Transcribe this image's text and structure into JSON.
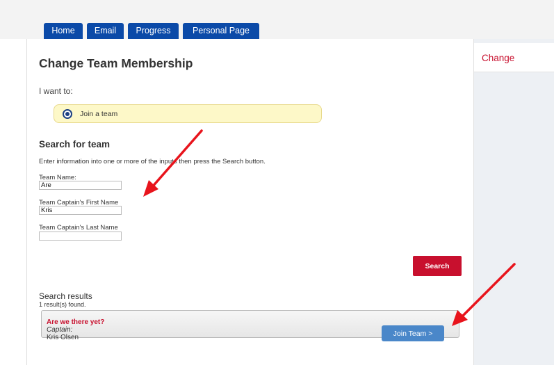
{
  "tabs": {
    "home": "Home",
    "email": "Email",
    "progress": "Progress",
    "personal": "Personal Page"
  },
  "right_panel": {
    "title": "Change"
  },
  "page": {
    "title": "Change Team Membership",
    "i_want_to": "I want to:",
    "join_option": "Join a team",
    "join_selected": true
  },
  "search": {
    "heading": "Search for team",
    "instructions": "Enter information into one or more of the inputs then press the Search button.",
    "fields": {
      "team_name": {
        "label": "Team Name:",
        "value": "Are"
      },
      "captain_first": {
        "label": "Team Captain's First Name",
        "value": "Kris"
      },
      "captain_last": {
        "label": "Team Captain's Last Name",
        "value": ""
      }
    },
    "button_label": "Search"
  },
  "results": {
    "heading": "Search results",
    "count_text": "1 result(s) found.",
    "items": [
      {
        "team_name": "Are we there yet?",
        "captain_label": "Captain:",
        "captain_name": "Kris Olsen",
        "join_label": "Join Team >"
      }
    ]
  },
  "colors": {
    "tab_blue": "#0b4aa8",
    "accent_red": "#c8102e",
    "join_button_blue": "#4a87c9",
    "highlight_yellow": "#fdf8c8",
    "annotation_arrow": "#e8141c"
  },
  "icons": {
    "radio": "radio-selected-icon",
    "annotation": "red-arrow-annotation"
  }
}
